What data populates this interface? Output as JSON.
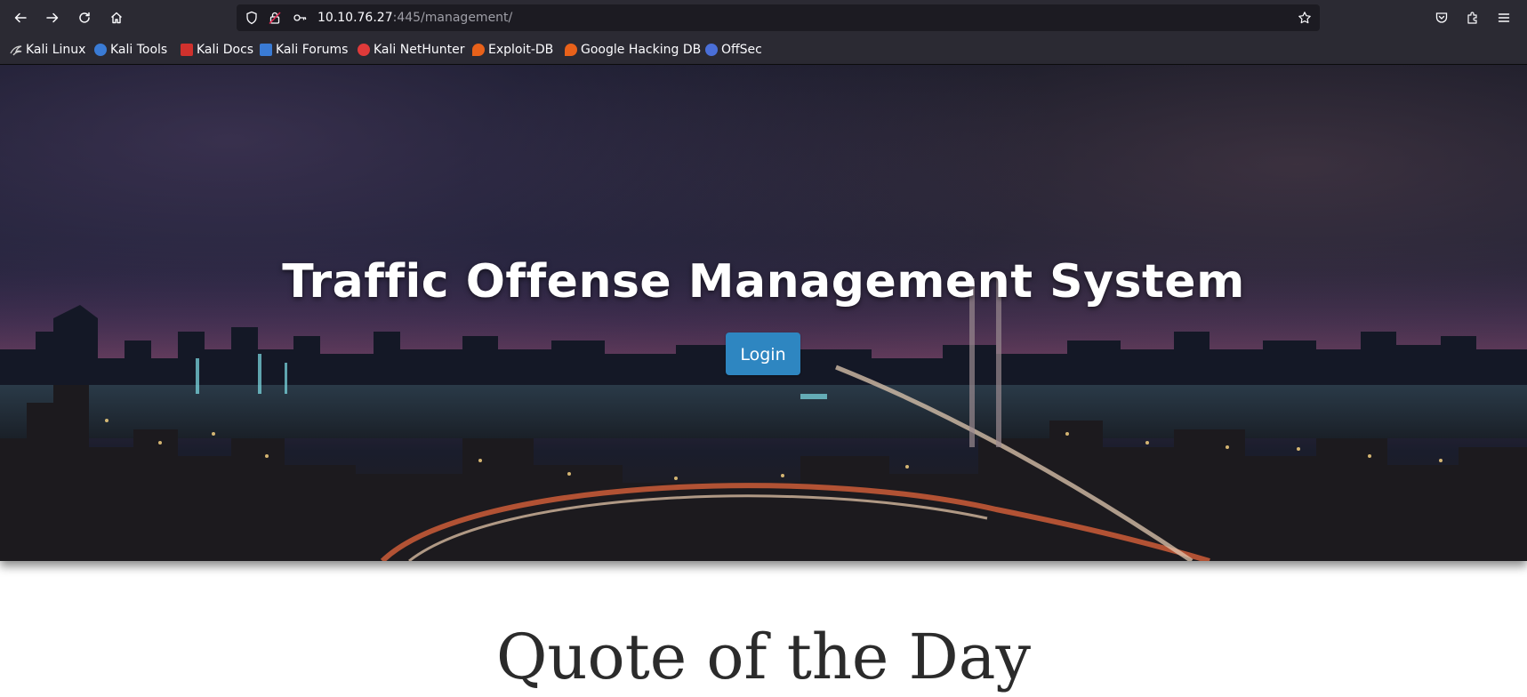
{
  "browser": {
    "url_host": "10.10.76.27",
    "url_path": ":445/management/",
    "bookmarks": [
      {
        "label": "Kali Linux",
        "icon": "kali-dragon-icon",
        "color": "#cccccc"
      },
      {
        "label": "Kali Tools",
        "icon": "kali-tools-icon",
        "color": "#3a7bd5"
      },
      {
        "label": "Kali Docs",
        "icon": "kali-docs-icon",
        "color": "#d0312d"
      },
      {
        "label": "Kali Forums",
        "icon": "kali-forums-icon",
        "color": "#3a7bd5"
      },
      {
        "label": "Kali NetHunter",
        "icon": "kali-nethunter-icon",
        "color": "#e03a3a"
      },
      {
        "label": "Exploit-DB",
        "icon": "exploit-db-icon",
        "color": "#e8611a"
      },
      {
        "label": "Google Hacking DB",
        "icon": "google-hacking-db-icon",
        "color": "#e8611a"
      },
      {
        "label": "OffSec",
        "icon": "offsec-icon",
        "color": "#4a6fd8"
      }
    ]
  },
  "page": {
    "hero_title": "Traffic Offense Management System",
    "login_label": "Login",
    "login_color": "#2e86c1",
    "quote_heading": "Quote of the Day"
  }
}
